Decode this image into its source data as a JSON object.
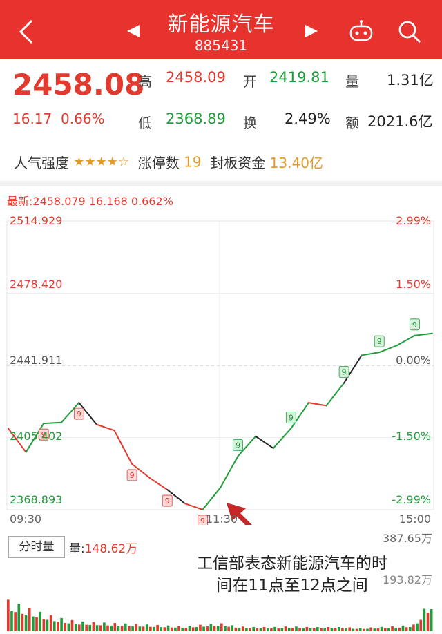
{
  "header": {
    "back_icon": "chevron-left-icon",
    "prev_icon": "triangle-left-icon",
    "next_icon": "triangle-right-icon",
    "title": "新能源汽车",
    "code": "885431",
    "robot_icon": "robot-icon",
    "search_icon": "search-icon",
    "accent_color": "#e8322e"
  },
  "quote": {
    "price": "2458.08",
    "change": "16.17",
    "change_pct": "0.66%",
    "high_label": "高",
    "high": "2458.09",
    "open_label": "开",
    "open": "2419.81",
    "volume_label": "量",
    "volume": "1.31亿",
    "low_label": "低",
    "low": "2368.89",
    "turnover_label": "换",
    "turnover": "2.49%",
    "amount_label": "额",
    "amount": "2021.6亿"
  },
  "hot": {
    "popularity_label": "人气强度",
    "stars_filled": 4,
    "stars_total": 5,
    "limit_up_label": "涨停数",
    "limit_up": "19",
    "seal_label": "封板资金",
    "seal": "13.40亿"
  },
  "intraday": {
    "latest_line": "最新:2458.079  16.168  0.662%",
    "y_left": [
      "2514.929",
      "2478.420",
      "2441.911",
      "2405.402",
      "2368.893"
    ],
    "y_right": [
      "2.99%",
      "1.50%",
      "0.00%",
      "-1.50%",
      "-2.99%"
    ],
    "x_labels": [
      "09:30",
      "11:30",
      "15:00"
    ],
    "marker_text": "9"
  },
  "volume_panel": {
    "tab_label": "分时量",
    "vol_label": "量:",
    "vol_value": "148.62万",
    "max": "387.65万",
    "mid": "193.82万"
  },
  "annotation": {
    "line1": "工信部表态新能源汽车的时",
    "line2": "间在11点至12点之间"
  },
  "chart_data": {
    "type": "line",
    "title": "",
    "xlabel": "",
    "ylabel": "",
    "x": [
      "09:30",
      "09:40",
      "09:50",
      "10:00",
      "10:10",
      "10:20",
      "10:30",
      "10:40",
      "10:50",
      "11:00",
      "11:10",
      "11:20",
      "11:30",
      "13:10",
      "13:20",
      "13:30",
      "13:40",
      "13:50",
      "14:00",
      "14:10",
      "14:20",
      "14:30",
      "14:40",
      "14:50",
      "15:00"
    ],
    "series": [
      {
        "values": [
          2410.0,
          2398.0,
          2412.5,
          2413.0,
          2423.0,
          2412.0,
          2409.0,
          2392.0,
          2385.0,
          2379.0,
          2372.0,
          2368.9,
          2380.0,
          2396.0,
          2406.0,
          2400.0,
          2410.0,
          2423.0,
          2421.5,
          2433.0,
          2447.0,
          2448.5,
          2452.0,
          2457.0,
          2458.08
        ]
      }
    ],
    "ylim": [
      2368.893,
      2514.929
    ],
    "baseline": 2441.911,
    "up_color": "#e23a2e",
    "down_color": "#1f9d3a",
    "neutral_color": "#222222",
    "volume": [
      0.38,
      0.3,
      0.22,
      0.16,
      0.12,
      0.11,
      0.1,
      0.09,
      0.08,
      0.07,
      0.06,
      0.08,
      0.1,
      0.06,
      0.05,
      0.05,
      0.06,
      0.05,
      0.05,
      0.05,
      0.04,
      0.05,
      0.06,
      0.08,
      0.4
    ]
  }
}
